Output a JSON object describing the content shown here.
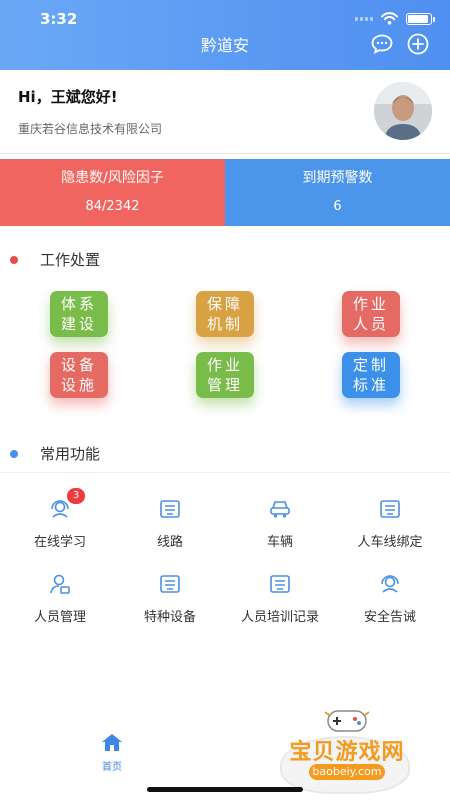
{
  "status_bar": {
    "time": "3:32",
    "battery_level": 0.9
  },
  "header": {
    "title": "黔道安",
    "chat_icon": "chat-bubble-icon",
    "add_icon": "plus-circle-icon"
  },
  "profile": {
    "greeting": "Hi，王斌您好!",
    "company": "重庆若谷信息技术有限公司"
  },
  "stats": [
    {
      "label": "隐患数/风险因子",
      "value": "84/2342",
      "color": "#f0655f"
    },
    {
      "label": "到期预警数",
      "value": "6",
      "color": "#4b95eb"
    }
  ],
  "work_section": {
    "title": "工作处置",
    "dot_color": "#e84b4b",
    "tiles": [
      {
        "line1": "体系",
        "line2": "建设",
        "color": "#79bc49"
      },
      {
        "line1": "保障",
        "line2": "机制",
        "color": "#d8a144"
      },
      {
        "line1": "作业",
        "line2": "人员",
        "color": "#e46a63"
      },
      {
        "line1": "设备",
        "line2": "设施",
        "color": "#e46a63"
      },
      {
        "line1": "作业",
        "line2": "管理",
        "color": "#79bc49"
      },
      {
        "line1": "定制",
        "line2": "标准",
        "color": "#3b90ea"
      }
    ]
  },
  "common_section": {
    "title": "常用功能",
    "dot_color": "#4b8fe6",
    "items": [
      {
        "label": "在线学习",
        "icon": "headset-icon",
        "badge": "3"
      },
      {
        "label": "线路",
        "icon": "route-icon"
      },
      {
        "label": "车辆",
        "icon": "car-icon"
      },
      {
        "label": "人车线绑定",
        "icon": "binding-icon"
      },
      {
        "label": "人员管理",
        "icon": "user-manage-icon"
      },
      {
        "label": "特种设备",
        "icon": "special-equipment-icon"
      },
      {
        "label": "人员培训记录",
        "icon": "training-record-icon"
      },
      {
        "label": "安全告诫",
        "icon": "safety-warning-icon"
      }
    ]
  },
  "nav": {
    "home_label": "首页",
    "accent": "#3b86e6"
  },
  "watermark": {
    "text": "宝贝游戏网",
    "url": "baobeiy.com"
  }
}
